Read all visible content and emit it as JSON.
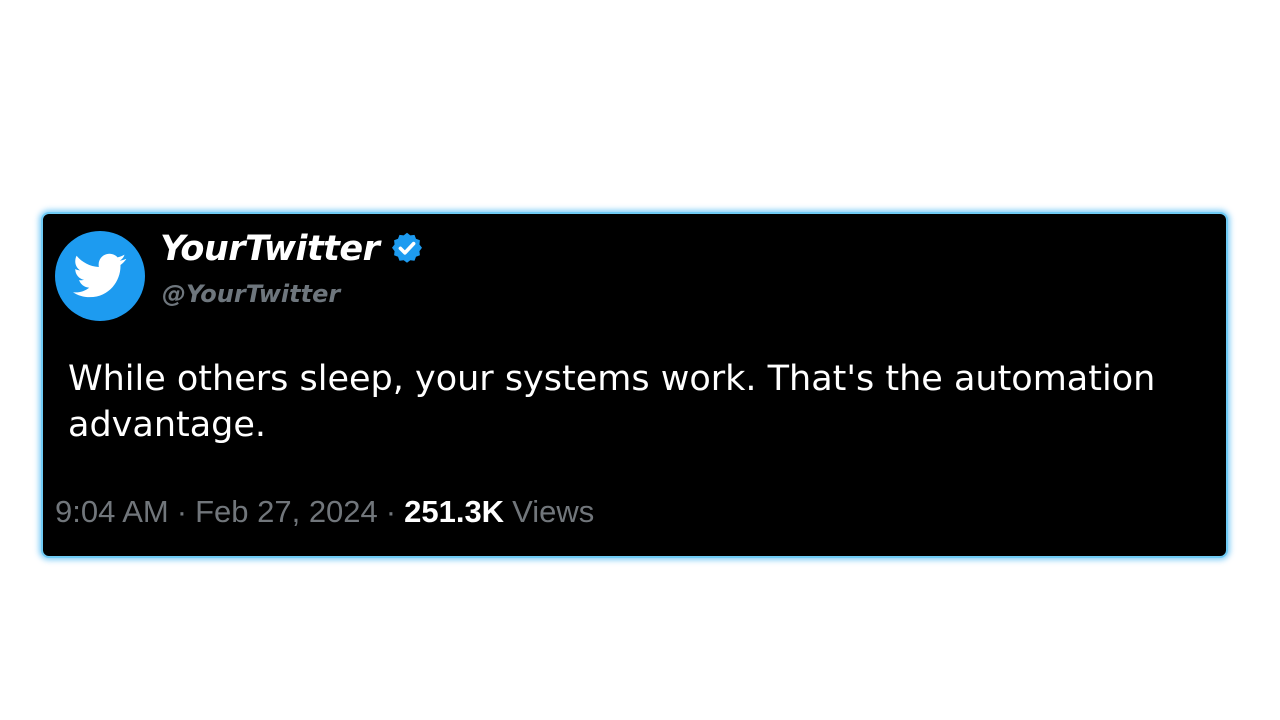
{
  "tweet": {
    "display_name": "YourTwitter",
    "handle": "@YourTwitter",
    "text": "While others sleep, your systems work. That's the automation advantage.",
    "time": "9:04 AM",
    "separator": "·",
    "date": "Feb 27, 2024",
    "views_count": "251.3K",
    "views_label": "Views",
    "avatar_icon": "twitter-bird-icon",
    "verified_icon": "verified-badge-icon"
  },
  "colors": {
    "card_background": "#000000",
    "card_border_glow": "#6fcbf5",
    "accent_blue": "#1d9bf0",
    "secondary_text": "#71767b",
    "primary_text": "#ffffff"
  }
}
